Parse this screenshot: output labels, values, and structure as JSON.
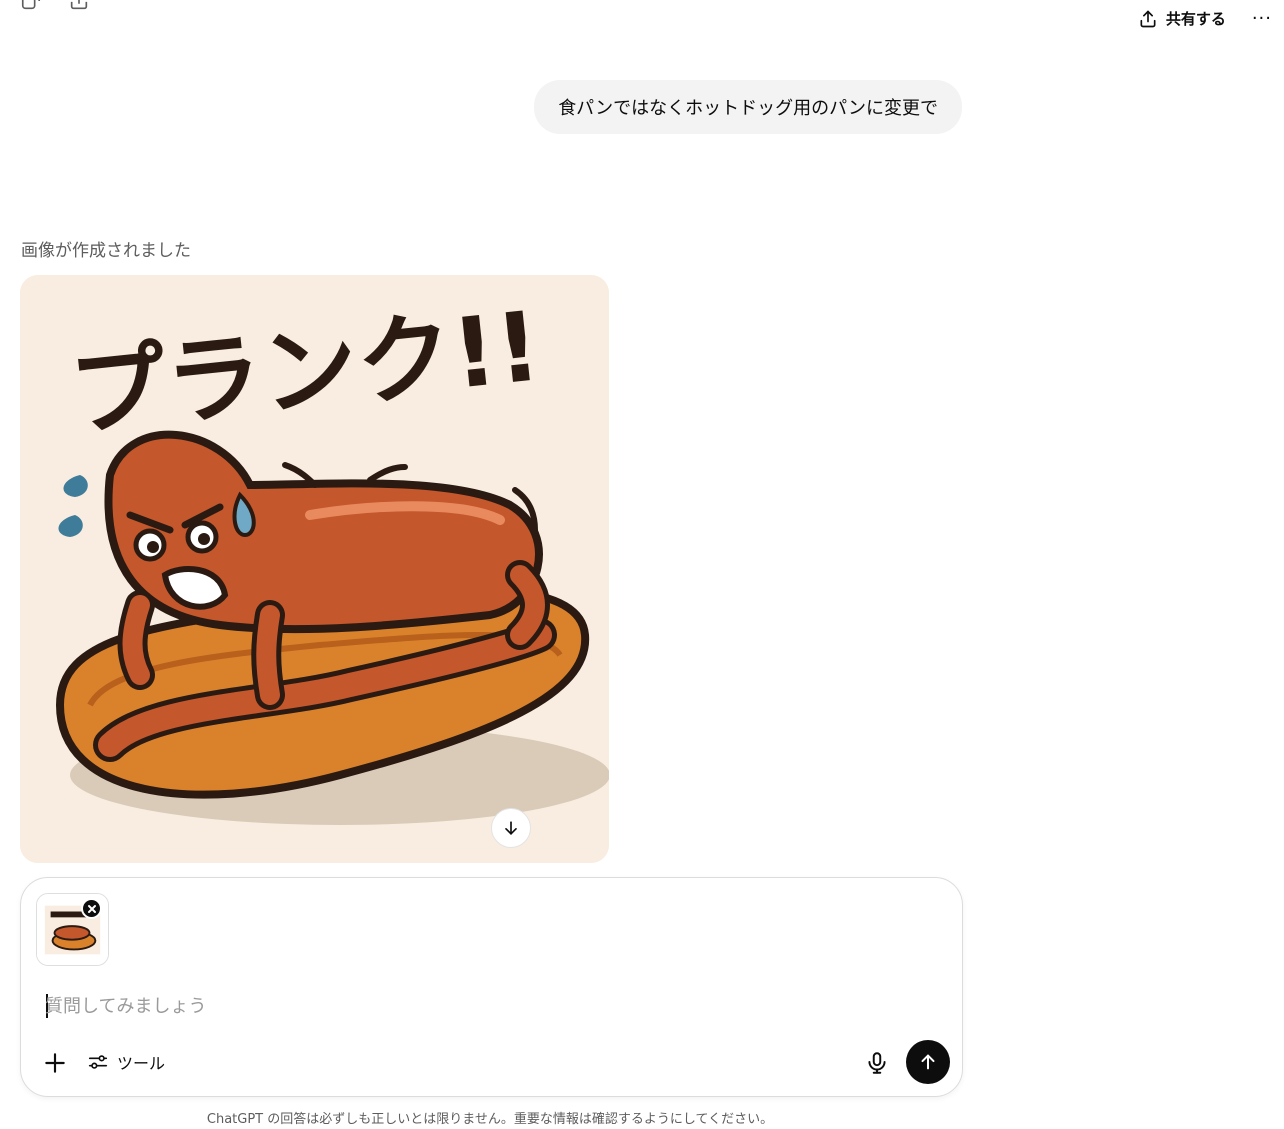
{
  "header": {
    "share_label": "共有する",
    "more_label": "···",
    "icons": [
      "new-chat-icon",
      "share-upload-icon",
      "share-icon",
      "more-icon"
    ]
  },
  "conversation": {
    "user_message": "食パンではなくホットドッグ用のパンに変更で",
    "assistant_status": "画像が作成されました",
    "image_title_text": "プランク!!"
  },
  "composer": {
    "placeholder": "質問してみましょう",
    "value": "",
    "tools_label": "ツール"
  },
  "footer": {
    "disclaimer": "ChatGPT の回答は必ずしも正しいとは限りません。重要な情報は確認するようにしてください。"
  },
  "colors": {
    "accent_dark": "#0d0d0d",
    "bubble_bg": "#f3f3f3",
    "image_bg": "#f8ede0"
  }
}
